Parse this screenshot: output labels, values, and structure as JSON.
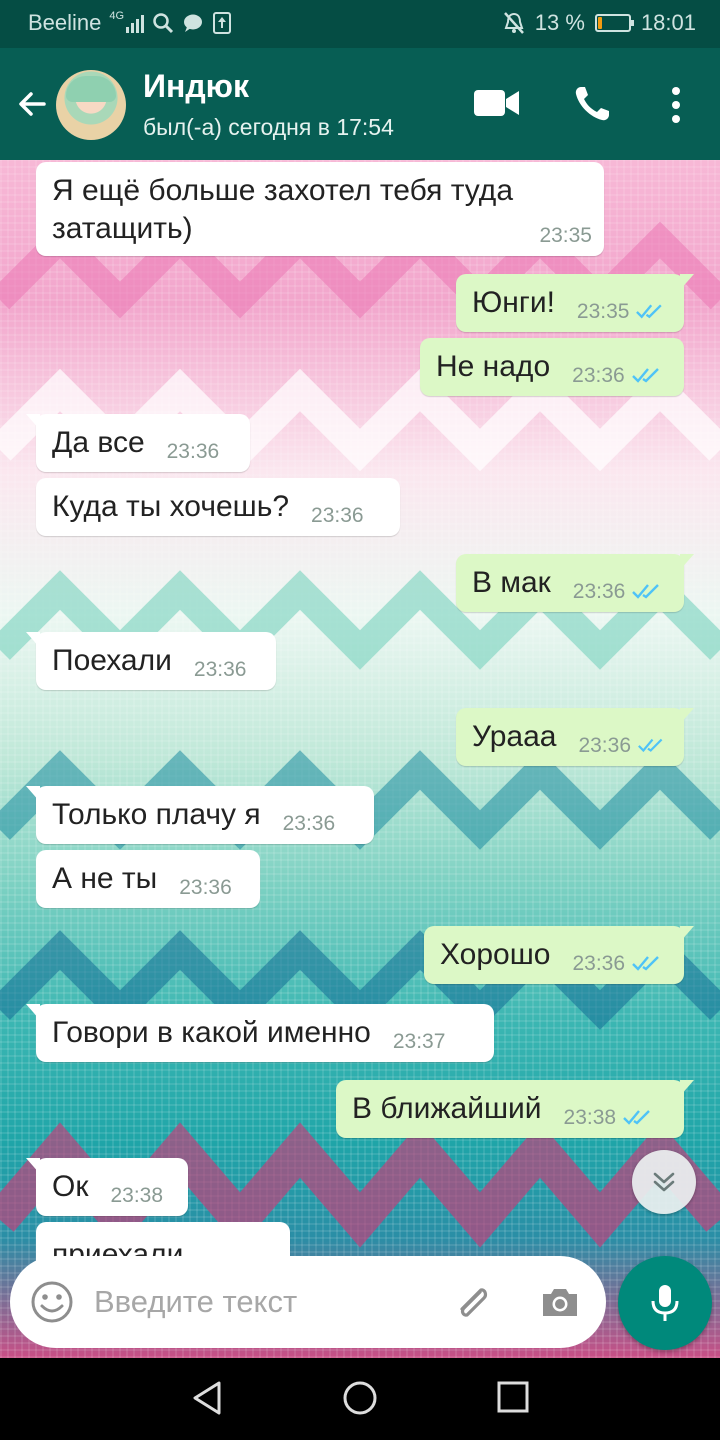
{
  "status_bar": {
    "carrier": "Beeline",
    "network": "4G",
    "battery_percent": "13 %",
    "battery_level": 0.13,
    "time": "18:01"
  },
  "header": {
    "contact_name": "Индюк",
    "contact_status": "был(-а) сегодня в 17:54",
    "icons": [
      "back-arrow-icon",
      "video-call-icon",
      "phone-icon",
      "more-vert-icon"
    ]
  },
  "messages": [
    {
      "dir": "in",
      "text": "Я ещё больше захотел тебя туда затащить)",
      "time": "23:35"
    },
    {
      "dir": "out",
      "text": "Юнги!",
      "time": "23:35",
      "read": true
    },
    {
      "dir": "out",
      "text": "Не надо",
      "time": "23:36",
      "read": true
    },
    {
      "dir": "in",
      "text": "Да все",
      "time": "23:36"
    },
    {
      "dir": "in",
      "text": "Куда ты хочешь?",
      "time": "23:36"
    },
    {
      "dir": "out",
      "text": "В мак",
      "time": "23:36",
      "read": true
    },
    {
      "dir": "in",
      "text": "Поехали",
      "time": "23:36"
    },
    {
      "dir": "out",
      "text": "Урааа",
      "time": "23:36",
      "read": true
    },
    {
      "dir": "in",
      "text": "Только плачу я",
      "time": "23:36"
    },
    {
      "dir": "in",
      "text": "А не ты",
      "time": "23:36"
    },
    {
      "dir": "out",
      "text": "Хорошо",
      "time": "23:36",
      "read": true
    },
    {
      "dir": "in",
      "text": "Говори в какой именно",
      "time": "23:37"
    },
    {
      "dir": "out",
      "text": "В ближайший",
      "time": "23:38",
      "read": true
    },
    {
      "dir": "in",
      "text": "Ок",
      "time": "23:38"
    },
    {
      "dir": "in",
      "text": "приехали",
      "time": ""
    }
  ],
  "composer": {
    "placeholder": "Введите текст",
    "icons": [
      "emoji-icon",
      "attach-icon",
      "camera-icon",
      "mic-icon"
    ]
  },
  "colors": {
    "header": "#075e54",
    "status_bar": "#054d44",
    "outgoing_bubble": "#dcf8c6",
    "incoming_bubble": "#ffffff",
    "read_ticks": "#4fc3f7",
    "mic_button": "#00897b"
  },
  "navigation": {
    "icons": [
      "back-triangle-icon",
      "home-circle-icon",
      "recents-square-icon"
    ]
  }
}
